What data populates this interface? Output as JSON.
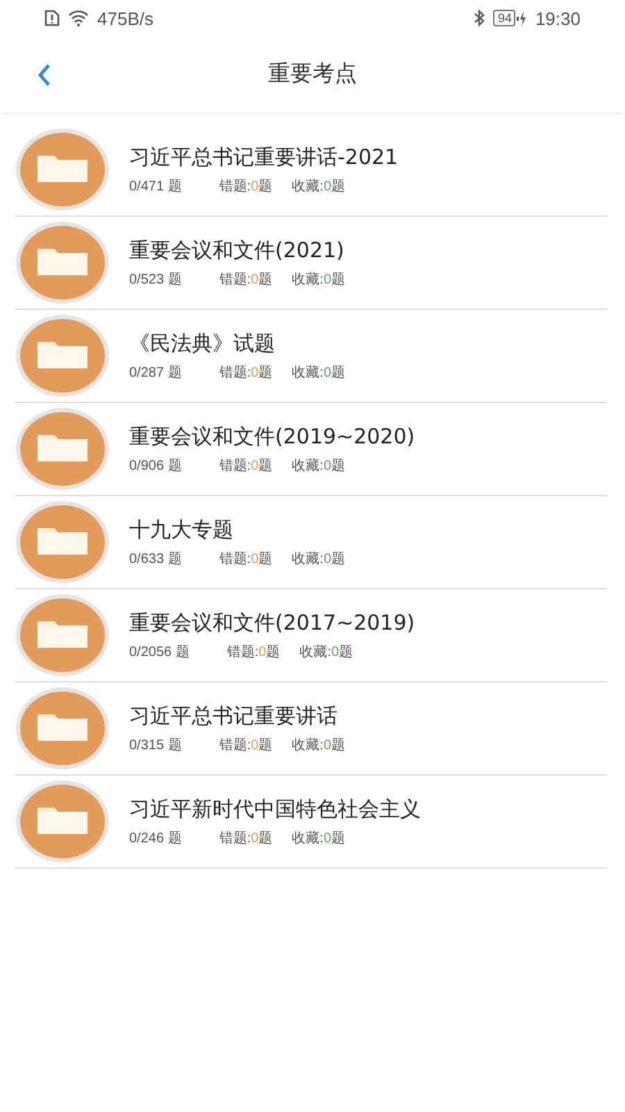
{
  "status_bar": {
    "network_speed": "475B/s",
    "battery": "94",
    "time": "19:30"
  },
  "header": {
    "title": "重要考点"
  },
  "items": [
    {
      "title": "习近平总书记重要讲话-2021",
      "progress": "0/471 题",
      "wrong": {
        "label": "错题:",
        "count": "0",
        "unit": "题"
      },
      "favorites": {
        "label": "收藏:",
        "count": "0",
        "unit": "题"
      }
    },
    {
      "title": "重要会议和文件(2021)",
      "progress": "0/523 题",
      "wrong": {
        "label": "错题:",
        "count": "0",
        "unit": "题"
      },
      "favorites": {
        "label": "收藏:",
        "count": "0",
        "unit": "题"
      }
    },
    {
      "title": "《民法典》试题",
      "progress": "0/287 题",
      "wrong": {
        "label": "错题:",
        "count": "0",
        "unit": "题"
      },
      "favorites": {
        "label": "收藏:",
        "count": "0",
        "unit": "题"
      }
    },
    {
      "title": "重要会议和文件(2019~2020)",
      "progress": "0/906 题",
      "wrong": {
        "label": "错题:",
        "count": "0",
        "unit": "题"
      },
      "favorites": {
        "label": "收藏:",
        "count": "0",
        "unit": "题"
      }
    },
    {
      "title": "十九大专题",
      "progress": "0/633 题",
      "wrong": {
        "label": "错题:",
        "count": "0",
        "unit": "题"
      },
      "favorites": {
        "label": "收藏:",
        "count": "0",
        "unit": "题"
      }
    },
    {
      "title": "重要会议和文件(2017~2019)",
      "progress": "0/2056 题",
      "wrong": {
        "label": "错题:",
        "count": "0",
        "unit": "题"
      },
      "favorites": {
        "label": "收藏:",
        "count": "0",
        "unit": "题"
      }
    },
    {
      "title": "习近平总书记重要讲话",
      "progress": "0/315 题",
      "wrong": {
        "label": "错题:",
        "count": "0",
        "unit": "题"
      },
      "favorites": {
        "label": "收藏:",
        "count": "0",
        "unit": "题"
      }
    },
    {
      "title": "习近平新时代中国特色社会主义",
      "progress": "0/246 题",
      "wrong": {
        "label": "错题:",
        "count": "0",
        "unit": "题"
      },
      "favorites": {
        "label": "收藏:",
        "count": "0",
        "unit": "题"
      }
    }
  ]
}
